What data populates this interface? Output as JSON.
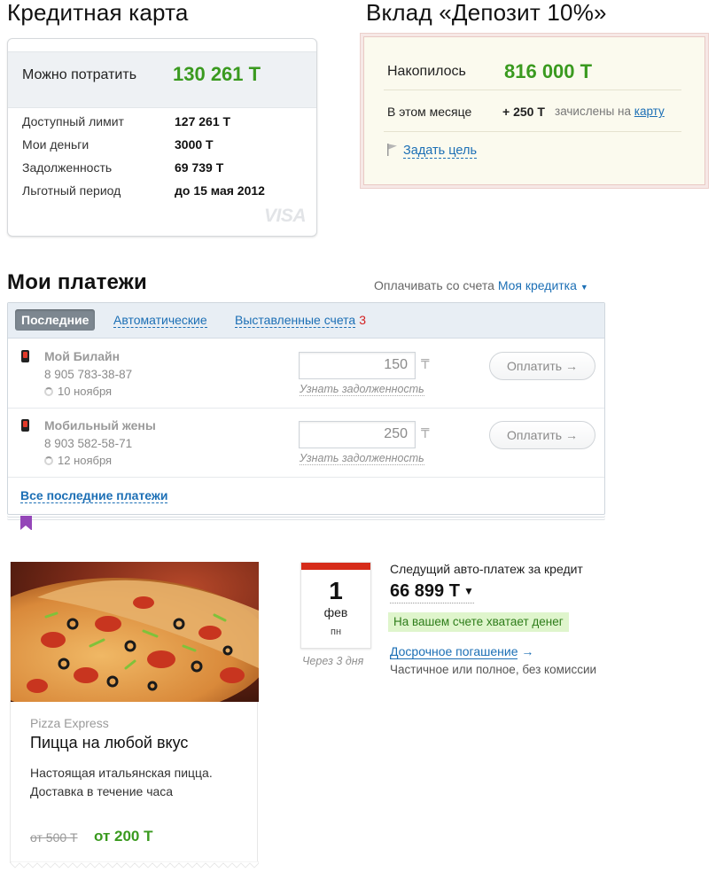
{
  "credit_card": {
    "title": "Кредитная карта",
    "spend_label": "Можно потратить",
    "spend_value": "130 261 Т",
    "rows": [
      {
        "label": "Доступный лимит",
        "value": "127 261 Т"
      },
      {
        "label": "Мои деньги",
        "value": "3000 Т"
      },
      {
        "label": "Задолженность",
        "value": "69 739 Т"
      },
      {
        "label": "Льготный период",
        "value": "до 15 мая 2012"
      }
    ],
    "brand": "VISA"
  },
  "deposit": {
    "title": "Вклад «Депозит 10%»",
    "accumulated_label": "Накопилось",
    "accumulated_value": "816 000 Т",
    "month_label": "В этом месяце",
    "month_amount": "+ 250 Т",
    "month_note_prefix": "зачислены на",
    "month_note_link": "карту",
    "goal_link": "Задать цель"
  },
  "payments": {
    "title": "Мои платежи",
    "pay_from_label": "Оплачивать со счета",
    "pay_from_account": "Моя кредитка",
    "tabs": [
      {
        "label": "Последние",
        "active": true
      },
      {
        "label": "Автоматические",
        "active": false
      },
      {
        "label": "Выставленные счета",
        "active": false,
        "badge": "3"
      }
    ],
    "items": [
      {
        "name": "Мой Билайн",
        "number": "8 905 783-38-87",
        "date": "10 ноября",
        "amount": "150",
        "currency": "₸",
        "debt_link": "Узнать задолженность",
        "button": "Оплатить →"
      },
      {
        "name": "Мобильный жены",
        "number": "8 903 582-58-71",
        "date": "12 ноября",
        "amount": "250",
        "currency": "₸",
        "debt_link": "Узнать задолженность",
        "button": "Оплатить →"
      }
    ],
    "all_link": "Все последние платежи"
  },
  "promo": {
    "brand": "Pizza Express",
    "title": "Пицца на любой вкус",
    "desc_line1": "Настоящая итальянская пицца.",
    "desc_line2": "Доставка в течение часа",
    "old_price": "от 500 Т",
    "new_price": "от 200 Т"
  },
  "auto_payment": {
    "day": "1",
    "month": "фев",
    "weekday": "пн",
    "due_note": "Через 3 дня",
    "title": "Следущий авто-платеж за кредит",
    "amount": "66 899 Т",
    "status": "На вашем счете хватает денег",
    "early_link": "Досрочное погашение",
    "early_arrow": "→",
    "early_sub": "Частичное или полное, без комиссии"
  },
  "colors": {
    "accent_green": "#3a9a1f",
    "link_blue": "#1c6fb5",
    "badge_red": "#d42020",
    "calendar_red": "#d62c1a"
  }
}
